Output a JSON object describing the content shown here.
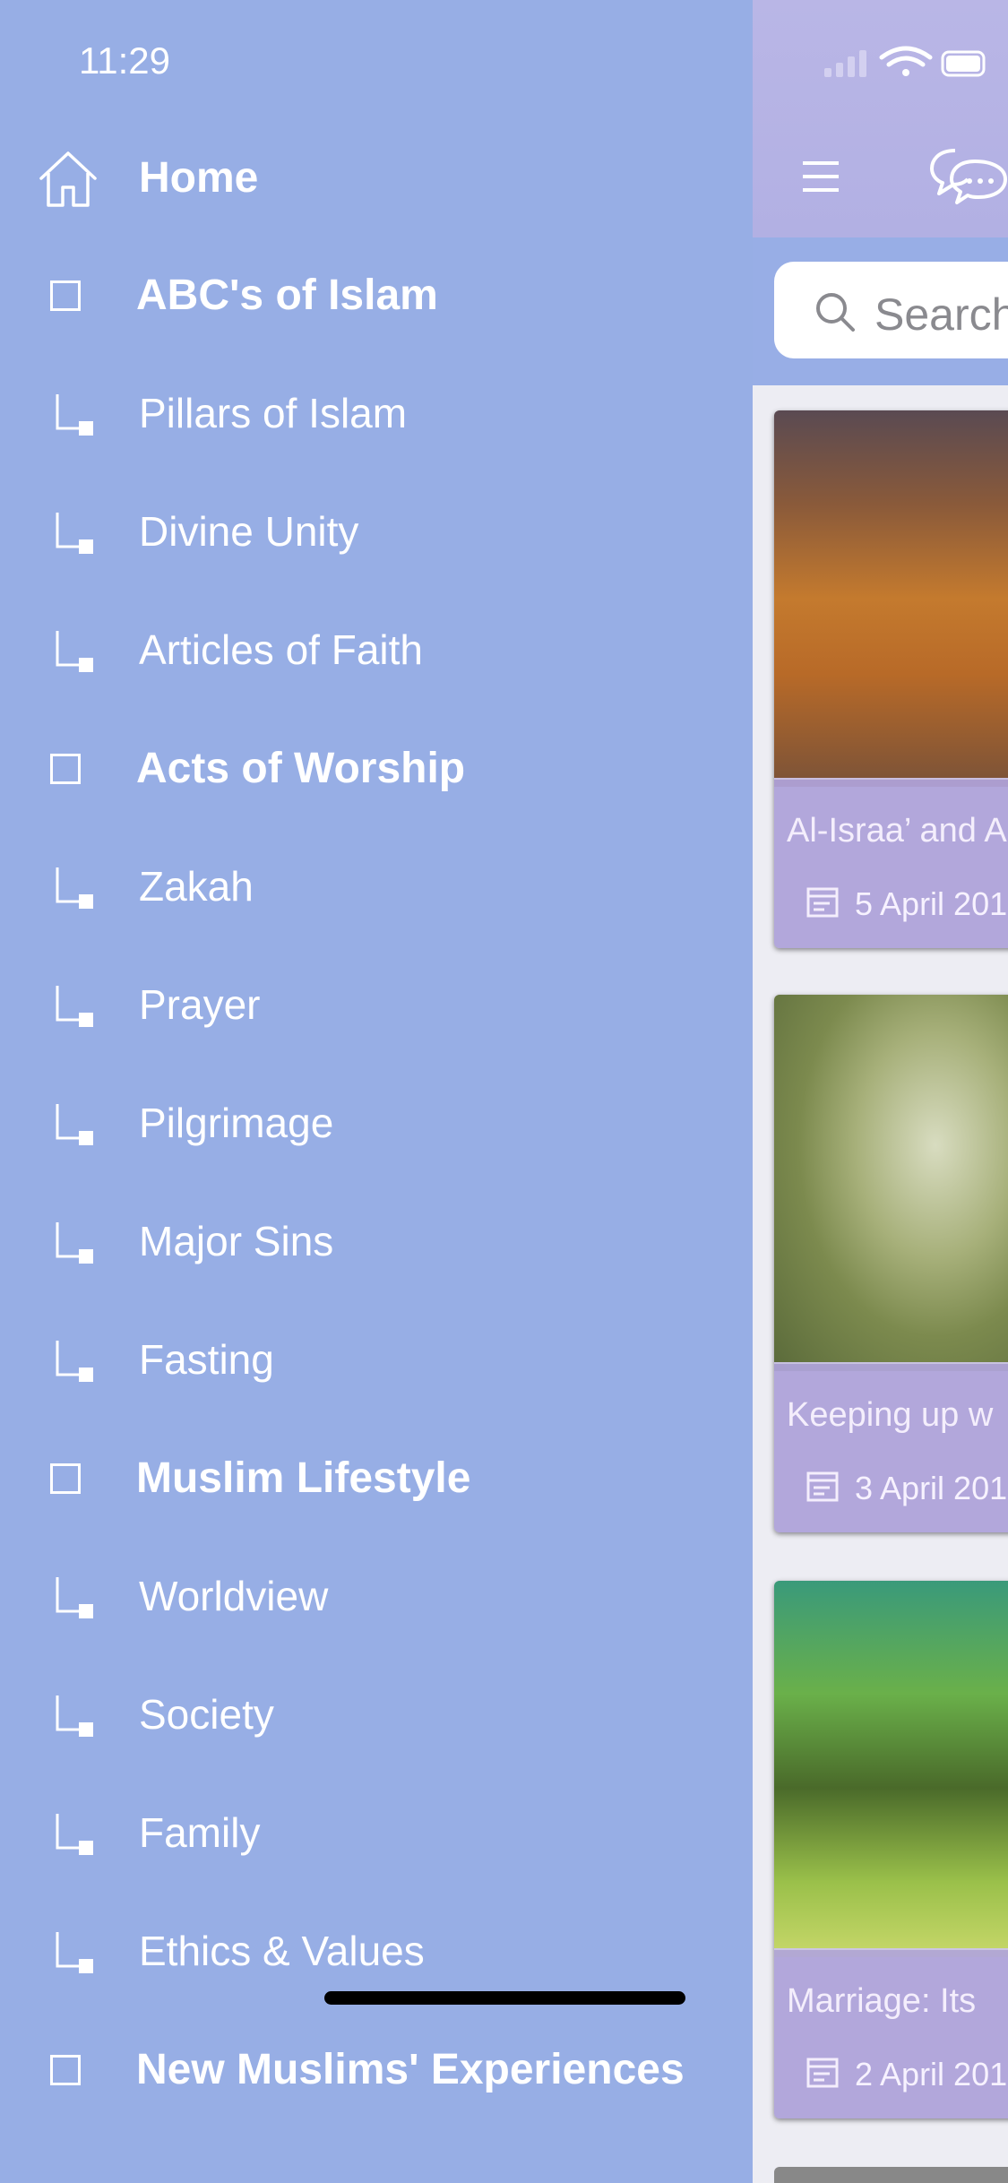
{
  "status": {
    "time": "11:29"
  },
  "drawer": {
    "home": {
      "label": "Home",
      "icon": "home-icon"
    },
    "items": [
      {
        "type": "section",
        "label": "ABC's of Islam"
      },
      {
        "type": "sub",
        "label": "Pillars of Islam"
      },
      {
        "type": "sub",
        "label": "Divine Unity"
      },
      {
        "type": "sub",
        "label": "Articles of Faith"
      },
      {
        "type": "section",
        "label": "Acts of Worship"
      },
      {
        "type": "sub",
        "label": "Zakah"
      },
      {
        "type": "sub",
        "label": "Prayer"
      },
      {
        "type": "sub",
        "label": "Pilgrimage"
      },
      {
        "type": "sub",
        "label": "Major Sins"
      },
      {
        "type": "sub",
        "label": "Fasting"
      },
      {
        "type": "section",
        "label": "Muslim Lifestyle"
      },
      {
        "type": "sub",
        "label": "Worldview"
      },
      {
        "type": "sub",
        "label": "Society"
      },
      {
        "type": "sub",
        "label": "Family"
      },
      {
        "type": "sub",
        "label": "Ethics & Values"
      },
      {
        "type": "section",
        "label": "New Muslims' Experiences"
      }
    ]
  },
  "main": {
    "toolbar": {
      "menu_icon": "hamburger-icon",
      "chat_icon": "chat-bubbles-icon"
    },
    "search": {
      "placeholder": "Search"
    },
    "articles": [
      {
        "title": "Al-Israa’ and A",
        "date": "5 April 201"
      },
      {
        "title": "Keeping up w",
        "date": "3 April 201"
      },
      {
        "title": "Marriage: Its",
        "date": "2 April 201"
      }
    ]
  },
  "colors": {
    "drawer_bg": "#97aee5",
    "topbar_bg": "#b6b3e4",
    "caption_bg": "#b0a4dc"
  }
}
